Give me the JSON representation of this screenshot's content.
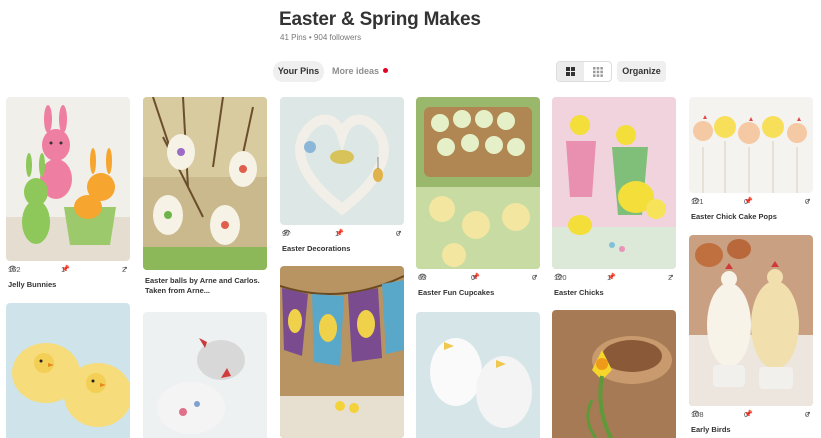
{
  "board": {
    "title": "Easter & Spring Makes",
    "meta": "41 Pins • 904 followers"
  },
  "tabs": {
    "your_pins": "Your Pins",
    "more_ideas": "More ideas"
  },
  "toolbar": {
    "organize": "Organize",
    "grid_view": "grid-large-icon",
    "compact_view": "grid-small-icon"
  },
  "colors": {
    "notification_dot": "#e60023",
    "tab_bg": "#efefef"
  },
  "pins": [
    {
      "title": "Jelly Bunnies",
      "views": "162",
      "repins": "1",
      "likes": "2"
    },
    {
      "title": "Easter balls by Arne and Carlos. Taken from Arne..."
    },
    {
      "title": "Easter Decorations",
      "views": "97",
      "repins": "1",
      "likes": "0"
    },
    {
      "title": "Easter Fun Cupcakes",
      "views": "63",
      "repins": "0",
      "likes": "0"
    },
    {
      "title": "Easter Chicks",
      "views": "120",
      "repins": "1",
      "likes": "2"
    },
    {
      "title": "Easter Chick Cake Pops",
      "views": "121",
      "repins": "0",
      "likes": "0"
    },
    {
      "title": "Early Birds",
      "views": "108",
      "repins": "0",
      "likes": "0"
    }
  ],
  "stat_icons": {
    "views": "eye-icon",
    "repins": "pin-icon",
    "likes": "like-icon"
  }
}
